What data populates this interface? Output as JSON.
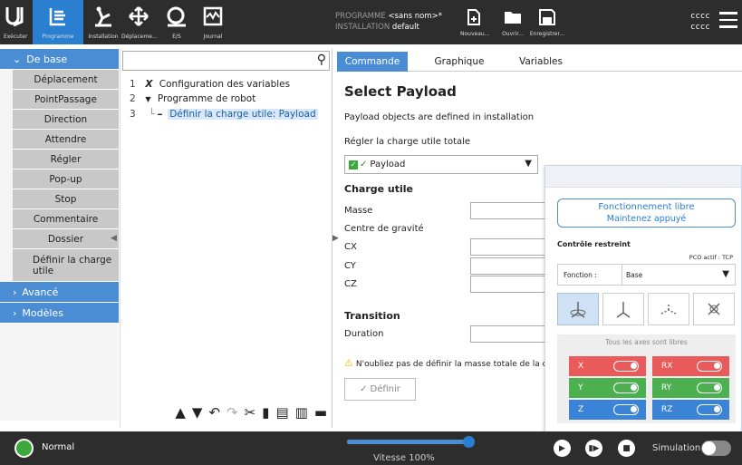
{
  "topnav": {
    "logo": "UR",
    "items": [
      {
        "label": "Exécuter",
        "icon": "run-icon"
      },
      {
        "label": "Programme",
        "icon": "program-icon"
      },
      {
        "label": "Installation",
        "icon": "installation-icon"
      },
      {
        "label": "Déplaceme...",
        "icon": "move-icon"
      },
      {
        "label": "E/S",
        "icon": "io-icon"
      },
      {
        "label": "Journal",
        "icon": "log-icon"
      }
    ],
    "program_label": "PROGRAMME",
    "program_value": "<sans nom>*",
    "installation_label": "INSTALLATION",
    "installation_value": "default",
    "file_buttons": [
      {
        "label": "Nouveau...",
        "icon": "new-file-icon"
      },
      {
        "label": "Ouvrir...",
        "icon": "open-folder-icon"
      },
      {
        "label": "Enregistrer...",
        "icon": "save-icon"
      }
    ],
    "user_line1": "cccc",
    "user_line2": "cccc"
  },
  "sidebar": {
    "section_basic": "De base",
    "items": [
      "Déplacement",
      "PointPassage",
      "Direction",
      "Attendre",
      "Régler",
      "Pop-up",
      "Stop",
      "Commentaire",
      "Dossier",
      "Définir la charge utile"
    ],
    "section_advanced": "Avancé",
    "section_templates": "Modèles"
  },
  "tree": {
    "rows": [
      {
        "num": "1",
        "mark": "X",
        "text": "Configuration des variables"
      },
      {
        "num": "2",
        "mark": "▼",
        "text": "Programme de robot"
      },
      {
        "num": "3",
        "mark": "━",
        "text": "Définir la charge utile: Payload"
      }
    ]
  },
  "tabs": [
    "Commande",
    "Graphique",
    "Variables"
  ],
  "command": {
    "title": "Select Payload",
    "info": "Payload objects are defined in installation",
    "total_label": "Régler la charge utile totale",
    "payload_value": "Payload",
    "payload_heading": "Charge utile",
    "mass_label": "Masse",
    "cog_label": "Centre de gravité",
    "cx_label": "CX",
    "cy_label": "CY",
    "cz_label": "CZ",
    "transition_heading": "Transition",
    "duration_label": "Duration",
    "warning": "N'oubliez pas de définir la masse totale de la c",
    "define_button": "Définir"
  },
  "freedrive": {
    "button_title": "Fonctionnement libre",
    "button_sub": "Maintenez appuyé",
    "restricted_label": "Contrôle restreint",
    "tcp_label": "PCO actif : TCP",
    "function_label": "Fonction :",
    "function_value": "Base",
    "axes_title": "Tous les axes sont libres",
    "axes": [
      {
        "label": "X",
        "color": "#e95b5b"
      },
      {
        "label": "RX",
        "color": "#e95b5b"
      },
      {
        "label": "Y",
        "color": "#4caf50"
      },
      {
        "label": "RY",
        "color": "#4caf50"
      },
      {
        "label": "Z",
        "color": "#3b83d6"
      },
      {
        "label": "RZ",
        "color": "#3b83d6"
      }
    ]
  },
  "bottom": {
    "status": "Normal",
    "speed_text": "Vitesse 100%",
    "speed_fraction": 1.0,
    "simulation_label": "Simulation"
  },
  "colors": {
    "accent": "#4b8dd4",
    "topbar": "#2d2d2d"
  }
}
